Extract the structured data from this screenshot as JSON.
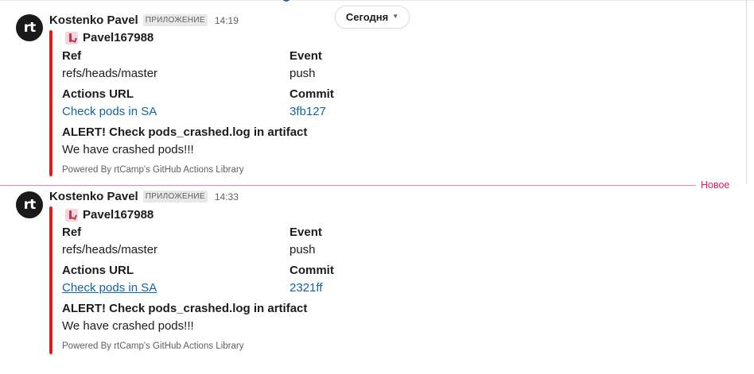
{
  "date_pill": {
    "label": "Сегодня"
  },
  "new_divider": {
    "label": "Новое"
  },
  "colors": {
    "attachment_bar": "#e01e1e",
    "link": "#1264a3",
    "new_divider": "#e01e5a"
  },
  "messages": [
    {
      "sender": "Kostenko Pavel",
      "badge": "ПРИЛОЖЕНИЕ",
      "time": "14:19",
      "avatar_text": "rt",
      "attachment": {
        "title": "Pavel167988",
        "icon": "github-actions-icon",
        "fields": {
          "ref_title": "Ref",
          "ref_value": "refs/heads/master",
          "event_title": "Event",
          "event_value": "push",
          "actions_title": "Actions URL",
          "actions_value": "Check pods in SA",
          "commit_title": "Commit",
          "commit_value": "3fb127"
        },
        "alert": "ALERT! Check pods_crashed.log in artifact",
        "text": "We have crashed pods!!!",
        "footer": "Powered By rtCamp's GitHub Actions Library"
      }
    },
    {
      "sender": "Kostenko Pavel",
      "badge": "ПРИЛОЖЕНИЕ",
      "time": "14:33",
      "avatar_text": "rt",
      "attachment": {
        "title": "Pavel167988",
        "icon": "github-actions-icon",
        "fields": {
          "ref_title": "Ref",
          "ref_value": "refs/heads/master",
          "event_title": "Event",
          "event_value": "push",
          "actions_title": "Actions URL",
          "actions_value": "Check pods in SA",
          "commit_title": "Commit",
          "commit_value": "2321ff"
        },
        "alert": "ALERT! Check pods_crashed.log in artifact",
        "text": "We have crashed pods!!!",
        "footer": "Powered By rtCamp's GitHub Actions Library"
      }
    }
  ]
}
